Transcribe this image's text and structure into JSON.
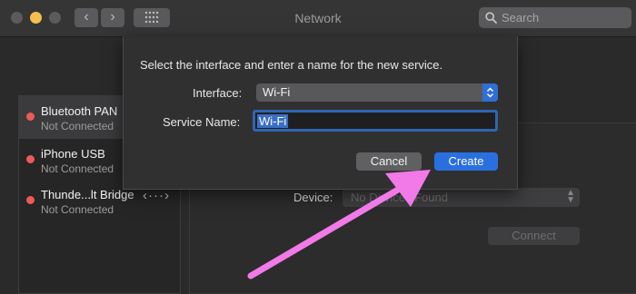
{
  "window": {
    "title": "Network"
  },
  "toolbar": {
    "back_icon": "chevron-left-icon",
    "forward_icon": "chevron-right-icon",
    "grid_icon": "grid-icon",
    "search_placeholder": "Search",
    "back_glyph": "‹",
    "forward_glyph": "›"
  },
  "services": [
    {
      "name": "Bluetooth PAN",
      "status": "Not Connected",
      "selected": true
    },
    {
      "name": "iPhone USB",
      "status": "Not Connected",
      "selected": false
    },
    {
      "name": "Thunde...lt Bridge",
      "status": "Not Connected",
      "selected": false
    }
  ],
  "services_arrows_glyph": "‹···›",
  "detail": {
    "device_label": "Device:",
    "device_value": "No Devices Found",
    "connect_label": "Connect"
  },
  "sheet": {
    "message": "Select the interface and enter a name for the new service.",
    "interface_label": "Interface:",
    "interface_value": "Wi-Fi",
    "service_name_label": "Service Name:",
    "service_name_value": "Wi-Fi",
    "cancel_label": "Cancel",
    "create_label": "Create"
  },
  "colors": {
    "accent": "#2a6fe0",
    "status_red": "#ec5b57",
    "traffic_yellow": "#f4bf4f",
    "annotation_arrow": "#f27ae8"
  }
}
